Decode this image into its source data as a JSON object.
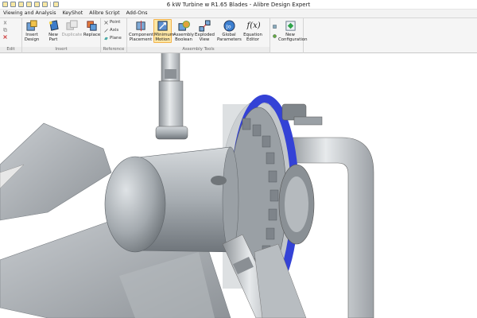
{
  "window": {
    "title": "6 kW Turbine w R1.65 Blades - Alibre Design Expert"
  },
  "qat_icons": [
    "new-icon",
    "open-icon",
    "save-icon",
    "print-icon",
    "undo-icon",
    "redo-icon",
    "options-icon"
  ],
  "menu_tabs": [
    "Viewing and Analysis",
    "KeyShot",
    "Alibre Script",
    "Add-Ons"
  ],
  "ribbon": {
    "groups": {
      "edit": "Edit",
      "insert": "Insert",
      "reference": "Reference",
      "assembly_tools": "Assembly Tools"
    },
    "buttons": {
      "insert_design": "Insert Design",
      "new_part": "New Part",
      "duplicate": "Duplicate",
      "replace": "Replace",
      "point": "Point",
      "axis": "Axis",
      "plane": "Plane",
      "component_placement": "Component Placement",
      "minimum_motion": "Minimum Motion",
      "assembly_boolean": "Assembly Boolean",
      "exploded_view": "Exploded View",
      "global_parameters": "Global Parameters",
      "equation_editor": "Equation Editor",
      "fx": "f(x)",
      "new_configuration": "New Configuration"
    }
  },
  "colors": {
    "ribbon_bg": "#f5f5f5",
    "highlight": "#fde7a6",
    "model_grey": "#a9aeb3",
    "model_blue": "#3b47d9"
  }
}
